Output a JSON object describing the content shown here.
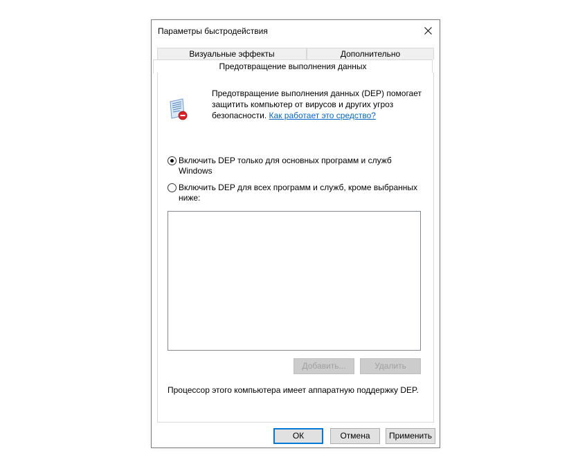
{
  "window": {
    "title": "Параметры быстродействия",
    "close_icon": "close-icon"
  },
  "tabs": {
    "row1": [
      {
        "label": "Визуальные эффекты"
      },
      {
        "label": "Дополнительно"
      }
    ],
    "active": {
      "label": "Предотвращение выполнения данных"
    }
  },
  "intro": {
    "icon": "dep-shield-icon",
    "text": "Предотвращение выполнения данных (DEP) помогает защитить компьютер от вирусов и других угроз безопасности.",
    "link": "Как работает это средство?"
  },
  "options": [
    {
      "label": "Включить DEP только для основных программ и служб Windows",
      "selected": true
    },
    {
      "label": "Включить DEP для всех программ и служб, кроме выбранных ниже:",
      "selected": false
    }
  ],
  "list": {
    "items": []
  },
  "list_buttons": {
    "add": "Добавить...",
    "remove": "Удалить"
  },
  "status": {
    "text": "Процессор этого компьютера имеет аппаратную поддержку DEP."
  },
  "footer": {
    "ok": "ОК",
    "cancel": "Отмена",
    "apply": "Применить"
  },
  "colors": {
    "link": "#0066cc",
    "focus_border": "#0078d7",
    "disabled_text": "#a0a0a0"
  }
}
